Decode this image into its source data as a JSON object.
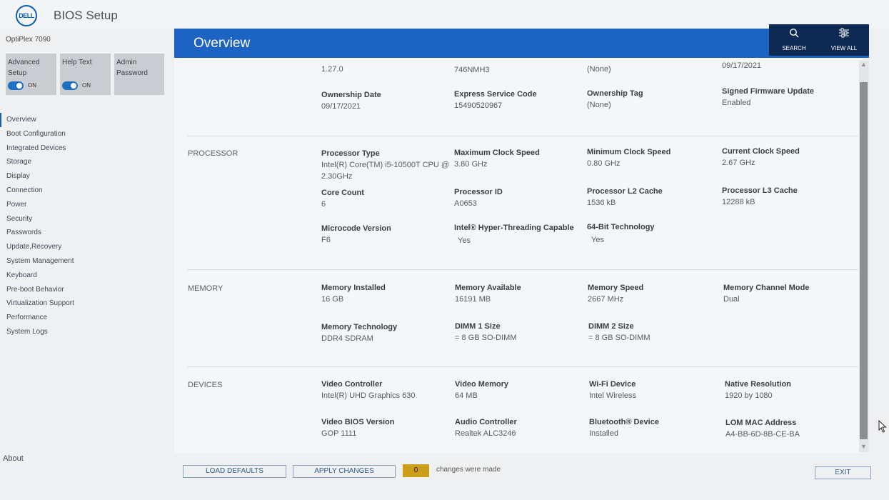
{
  "app": {
    "logo_text": "DELL",
    "title": "BIOS Setup",
    "model": "OptiPlex 7090"
  },
  "tiles": [
    {
      "label": "Advanced Setup",
      "toggle": "ON"
    },
    {
      "label": "Help Text",
      "toggle": "ON"
    },
    {
      "label": "Admin Password"
    }
  ],
  "nav": [
    "Overview",
    "Boot Configuration",
    "Integrated Devices",
    "Storage",
    "Display",
    "Connection",
    "Power",
    "Security",
    "Passwords",
    "Update,Recovery",
    "System Management",
    "Keyboard",
    "Pre-boot Behavior",
    "Virtualization Support",
    "Performance",
    "System Logs"
  ],
  "about": "About",
  "header": {
    "title": "Overview",
    "search_label": "SEARCH",
    "viewall_label": "VIEW ALL",
    "search_icon": "search-icon",
    "viewall_icon": "sliders-icon"
  },
  "system": {
    "top_values": [
      "1.27.0",
      "746NMH3",
      "(None)",
      "09/17/2021"
    ],
    "fields": [
      {
        "label": "Ownership Date",
        "value": "09/17/2021"
      },
      {
        "label": "Express Service Code",
        "value": "15490520967"
      },
      {
        "label": "Ownership Tag",
        "value": "(None)"
      },
      {
        "label": "Signed Firmware Update",
        "value": "Enabled"
      }
    ]
  },
  "processor": {
    "section": "PROCESSOR",
    "fields": [
      {
        "label": "Processor Type",
        "value": "Intel(R) Core(TM) i5-10500T CPU @ 2.30GHz"
      },
      {
        "label": "Maximum Clock Speed",
        "value": "3.80 GHz"
      },
      {
        "label": "Minimum Clock Speed",
        "value": "0.80 GHz"
      },
      {
        "label": "Current Clock Speed",
        "value": "2.67 GHz"
      },
      {
        "label": "Core Count",
        "value": "6"
      },
      {
        "label": "Processor ID",
        "value": "A0653"
      },
      {
        "label": "Processor L2 Cache",
        "value": "1536 kB"
      },
      {
        "label": "Processor L3 Cache",
        "value": "12288 kB"
      },
      {
        "label": "Microcode Version",
        "value": "F6"
      },
      {
        "label": "Intel® Hyper-Threading Capable",
        "value": "Yes"
      },
      {
        "label": "64-Bit Technology",
        "value": "Yes"
      }
    ]
  },
  "memory": {
    "section": "MEMORY",
    "fields": [
      {
        "label": "Memory Installed",
        "value": "16 GB"
      },
      {
        "label": "Memory Available",
        "value": "16191 MB"
      },
      {
        "label": "Memory Speed",
        "value": "2667 MHz"
      },
      {
        "label": "Memory Channel Mode",
        "value": "Dual"
      },
      {
        "label": "Memory Technology",
        "value": "DDR4 SDRAM"
      },
      {
        "label": "DIMM 1 Size",
        "value": "= 8 GB SO-DIMM"
      },
      {
        "label": "DIMM 2 Size",
        "value": "= 8 GB SO-DIMM"
      }
    ]
  },
  "devices": {
    "section": "DEVICES",
    "fields": [
      {
        "label": "Video Controller",
        "value": "Intel(R) UHD Graphics 630"
      },
      {
        "label": "Video Memory",
        "value": "64 MB"
      },
      {
        "label": "Wi-Fi Device",
        "value": "Intel Wireless"
      },
      {
        "label": "Native Resolution",
        "value": "1920 by 1080"
      },
      {
        "label": "Video BIOS Version",
        "value": "GOP 1111"
      },
      {
        "label": "Audio Controller",
        "value": "Realtek ALC3246"
      },
      {
        "label": "Bluetooth® Device",
        "value": "Installed"
      },
      {
        "label": "LOM MAC Address",
        "value": "A4-BB-6D-8B-CE-BA"
      }
    ]
  },
  "footer": {
    "load_defaults": "LOAD DEFAULTS",
    "apply_changes": "APPLY CHANGES",
    "changes_count": "0",
    "changes_text": "changes were made",
    "exit": "EXIT"
  },
  "colors": {
    "header_blue": "#1d63c4",
    "header_button": "#0e2a52",
    "badge": "#cc9e1a",
    "toggle": "#1f6fc0"
  }
}
